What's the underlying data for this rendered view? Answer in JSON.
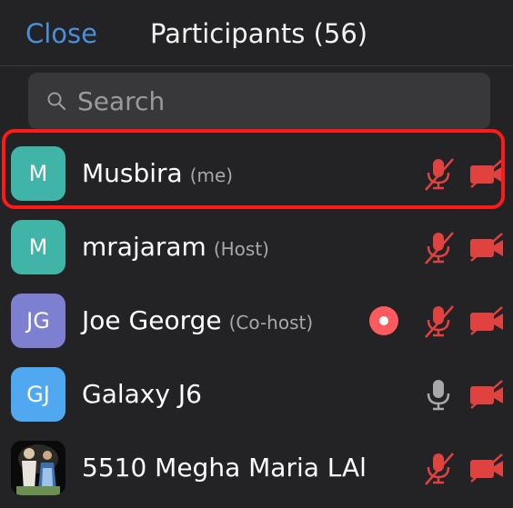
{
  "header": {
    "close_label": "Close",
    "title": "Participants (56)"
  },
  "search": {
    "placeholder": "Search",
    "icon": "search-icon"
  },
  "colors": {
    "accent": "#4a90d9",
    "muted_red": "#e0423f",
    "highlight_border": "#ff1a1a",
    "teal_avatar": "#3fb4a7",
    "purple_avatar": "#7d7fd1",
    "blue_avatar": "#4fa8f0"
  },
  "participants": [
    {
      "initials": "M",
      "name": "Musbira",
      "role": "(me)",
      "avatar_color": "#3fb4a7",
      "mic": "muted",
      "video": "off",
      "recording": false,
      "highlighted": true
    },
    {
      "initials": "M",
      "name": "mrajaram",
      "role": "(Host)",
      "avatar_color": "#3fb4a7",
      "mic": "muted",
      "video": "off",
      "recording": false,
      "highlighted": false
    },
    {
      "initials": "JG",
      "name": "Joe George",
      "role": "(Co-host)",
      "avatar_color": "#7d7fd1",
      "mic": "muted",
      "video": "off",
      "recording": true,
      "highlighted": false
    },
    {
      "initials": "GJ",
      "name": "Galaxy J6",
      "role": "",
      "avatar_color": "#4fa8f0",
      "mic": "on",
      "video": "off",
      "recording": false,
      "highlighted": false
    },
    {
      "initials": "",
      "name": "5510 Megha Maria LAl",
      "role": "",
      "avatar_color": "#000000",
      "avatar_image": "religious-figures-photo",
      "mic": "muted",
      "video": "off",
      "recording": false,
      "highlighted": false
    }
  ]
}
